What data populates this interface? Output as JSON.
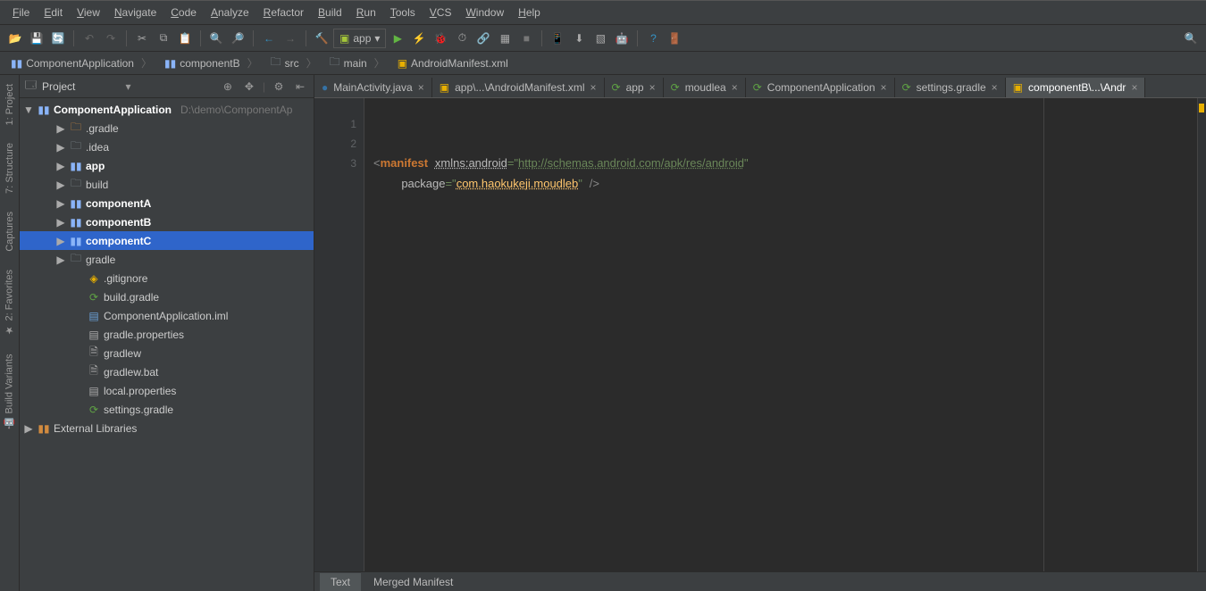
{
  "menu": [
    "File",
    "Edit",
    "View",
    "Navigate",
    "Code",
    "Analyze",
    "Refactor",
    "Build",
    "Run",
    "Tools",
    "VCS",
    "Window",
    "Help"
  ],
  "run_config": "app",
  "breadcrumbs": [
    {
      "icon": "module",
      "label": "ComponentApplication"
    },
    {
      "icon": "module",
      "label": "componentB"
    },
    {
      "icon": "folder",
      "label": "src"
    },
    {
      "icon": "folder",
      "label": "main"
    },
    {
      "icon": "xml",
      "label": "AndroidManifest.xml"
    }
  ],
  "left_rail": [
    "1: Project",
    "7: Structure",
    "Captures",
    "2: Favorites",
    "Build Variants"
  ],
  "project_panel": {
    "title": "Project",
    "root": {
      "name": "ComponentApplication",
      "path": "D:\\demo\\ComponentAp"
    },
    "items": [
      {
        "depth": 1,
        "arrow": "▶",
        "icon": "folder-orange",
        "name": ".gradle"
      },
      {
        "depth": 1,
        "arrow": "▶",
        "icon": "folder-gray",
        "name": ".idea"
      },
      {
        "depth": 1,
        "arrow": "▶",
        "icon": "module",
        "name": "app",
        "bold": true
      },
      {
        "depth": 1,
        "arrow": "▶",
        "icon": "folder-gray",
        "name": "build"
      },
      {
        "depth": 1,
        "arrow": "▶",
        "icon": "module",
        "name": "componentA",
        "bold": true
      },
      {
        "depth": 1,
        "arrow": "▶",
        "icon": "module",
        "name": "componentB",
        "bold": true
      },
      {
        "depth": 1,
        "arrow": "▶",
        "icon": "module",
        "name": "componentC",
        "bold": true,
        "selected": true
      },
      {
        "depth": 1,
        "arrow": "▶",
        "icon": "folder-gray",
        "name": "gradle"
      },
      {
        "depth": 2,
        "arrow": "",
        "icon": "git",
        "name": ".gitignore"
      },
      {
        "depth": 2,
        "arrow": "",
        "icon": "gradle",
        "name": "build.gradle"
      },
      {
        "depth": 2,
        "arrow": "",
        "icon": "iml",
        "name": "ComponentApplication.iml"
      },
      {
        "depth": 2,
        "arrow": "",
        "icon": "props",
        "name": "gradle.properties"
      },
      {
        "depth": 2,
        "arrow": "",
        "icon": "file",
        "name": "gradlew"
      },
      {
        "depth": 2,
        "arrow": "",
        "icon": "file",
        "name": "gradlew.bat"
      },
      {
        "depth": 2,
        "arrow": "",
        "icon": "props",
        "name": "local.properties"
      },
      {
        "depth": 2,
        "arrow": "",
        "icon": "gradle",
        "name": "settings.gradle"
      }
    ],
    "ext_lib": "External Libraries"
  },
  "tabs": [
    {
      "icon": "java",
      "label": "MainActivity.java"
    },
    {
      "icon": "xml",
      "label": "app\\...\\AndroidManifest.xml"
    },
    {
      "icon": "gradle",
      "label": "app"
    },
    {
      "icon": "gradle",
      "label": "moudlea"
    },
    {
      "icon": "gradle",
      "label": "ComponentApplication"
    },
    {
      "icon": "gradle",
      "label": "settings.gradle"
    },
    {
      "icon": "xml",
      "label": "componentB\\...\\Andr",
      "active": true
    }
  ],
  "editor": {
    "lines": [
      "1",
      "2",
      "3"
    ],
    "code": {
      "l1_tag": "manifest",
      "l1_attr": "xmlns:android",
      "l1_val": "http://schemas.android.com/apk/res/android",
      "l2_attr": "package",
      "l2_val": "com.haokukeji.moudleb"
    }
  },
  "bottom_tabs": [
    "Text",
    "Merged Manifest"
  ]
}
